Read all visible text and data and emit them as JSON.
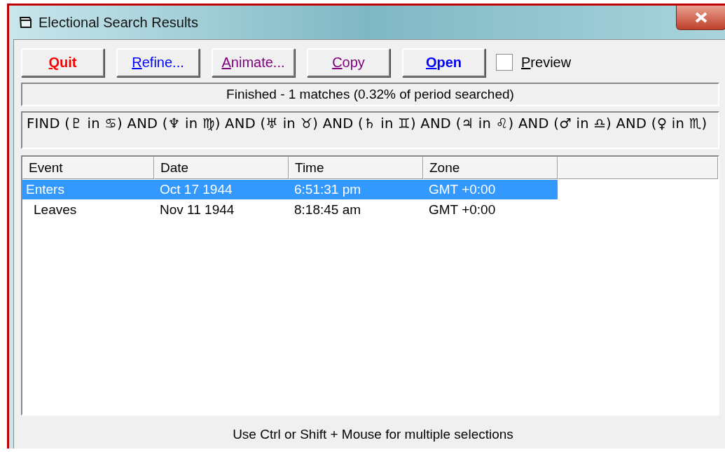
{
  "window": {
    "title": "Electional Search Results"
  },
  "buttons": [
    {
      "label": "Quit",
      "color": "#ff0000",
      "bold": true
    },
    {
      "label": "Refine...",
      "color": "#0000ff",
      "bold": false
    },
    {
      "label": "Animate...",
      "color": "#800080",
      "bold": false
    },
    {
      "label": "Copy",
      "color": "#800080",
      "bold": false
    },
    {
      "label": "Open",
      "color": "#0000ff",
      "bold": true
    }
  ],
  "preview": {
    "label": "Preview",
    "checked": false
  },
  "status": "Finished - 1 matches  (0.32% of period searched)",
  "query": "FIND  (♇ in ♋) AND  (♆ in ♍) AND  (♅ in ♉) AND  (♄ in ♊) AND  (♃ in ♌) AND  (♂ in ♎) AND  (♀ in ♏)",
  "table": {
    "columns": [
      "Event",
      "Date",
      "Time",
      "Zone"
    ],
    "rows": [
      {
        "cells": [
          "Enters",
          "Oct 17 1944",
          "6:51:31 pm",
          "GMT +0:00"
        ],
        "selected": true
      },
      {
        "cells": [
          "Leaves",
          "Nov 11 1944",
          "8:18:45 am",
          "GMT +0:00"
        ],
        "selected": false
      }
    ]
  },
  "footer": "Use Ctrl or Shift + Mouse for multiple selections"
}
